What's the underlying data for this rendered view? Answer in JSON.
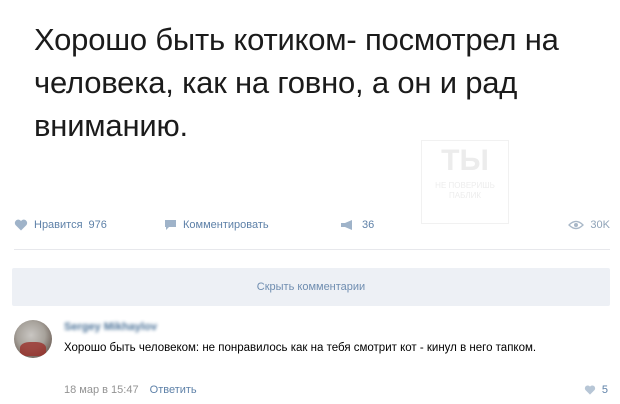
{
  "post": {
    "text": "Хорошо быть котиком- посмотрел на человека, как на говно, а он и рад вниманию."
  },
  "watermark": {
    "big": "ТЫ",
    "small1": "НЕ ПОВЕРИШЬ",
    "small2": "ПАБЛИК"
  },
  "actions": {
    "like_label": "Нравится",
    "like_count": "976",
    "comment_label": "Комментировать",
    "share_count": "36",
    "views_count": "30K"
  },
  "hide_comments_label": "Скрыть комментарии",
  "comment": {
    "author": "Sergey Mikhaylov",
    "text": "Хорошо быть человеком: не понравилось как на тебя смотрит кот - кинул в него тапком.",
    "date": "18 мар в 15:47",
    "reply_label": "Ответить",
    "like_count": "5"
  },
  "colors": {
    "link": "#5e81a8",
    "bar_bg": "#edf0f5",
    "author": "#2a5885"
  }
}
